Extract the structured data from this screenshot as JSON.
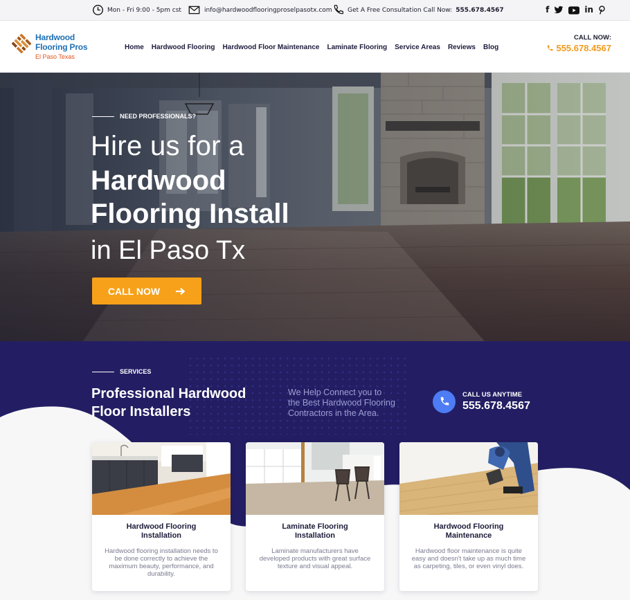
{
  "topbar": {
    "hours": "Mon - Fri 9:00 - 5pm cst",
    "email": "info@hardwoodflooringproselpasotx.com",
    "consult_label": "Get A Free Consultation Call Now:",
    "consult_phone": "555.678.4567",
    "social_icons": [
      "facebook-icon",
      "twitter-icon",
      "youtube-icon",
      "linkedin-icon",
      "pinterest-icon"
    ]
  },
  "header": {
    "logo_line1": "Hardwood",
    "logo_line2": "Flooring Pros",
    "logo_line3": "El Paso Texas",
    "nav": [
      {
        "label": "Home"
      },
      {
        "label": "Hardwood Flooring"
      },
      {
        "label": "Hardwood Floor Maintenance"
      },
      {
        "label": "Laminate Flooring"
      },
      {
        "label": "Service Areas"
      },
      {
        "label": "Reviews"
      },
      {
        "label": "Blog"
      }
    ],
    "call_label": "CALL NOW:",
    "call_phone": "555.678.4567"
  },
  "hero": {
    "kicker": "NEED PROFESSIONALS?",
    "line1": "Hire us for a",
    "line2": "Hardwood",
    "line3": "Flooring Install",
    "line4": "in El Paso Tx",
    "cta_label": "CALL NOW"
  },
  "services": {
    "kicker": "SERVICES",
    "title_line1": "Professional Hardwood",
    "title_line2": "Floor Installers",
    "desc_line1": "We Help Connect you to",
    "desc_line2": "the Best Hardwood Flooring",
    "desc_line3": "Contractors in the Area.",
    "call_label": "CALL US ANYTIME",
    "call_phone": "555.678.4567",
    "cards": [
      {
        "title_line1": "Hardwood Flooring",
        "title_line2": "Installation",
        "desc_lines": [
          "Hardwood flooring installation needs to",
          "be done correctly to achieve the",
          "maximum beauty, performance, and",
          "durability."
        ]
      },
      {
        "title_line1": "Laminate Flooring",
        "title_line2": "Installation",
        "desc_lines": [
          "Laminate manufacturers have",
          "developed products with great surface",
          "texture and visual appeal."
        ]
      },
      {
        "title_line1": "Hardwood Flooring",
        "title_line2": "Maintenance",
        "desc_lines": [
          "Hardwood floor maintenance is quite",
          "easy and doesn't take up as much time",
          "as carpeting, tiles, or even vinyl does."
        ]
      }
    ]
  },
  "colors": {
    "accent_orange": "#f7a11a",
    "navy": "#231e63",
    "brand_blue": "#1f6fb3",
    "brand_orange": "#e2531d",
    "call_blue": "#4d7cf4"
  }
}
